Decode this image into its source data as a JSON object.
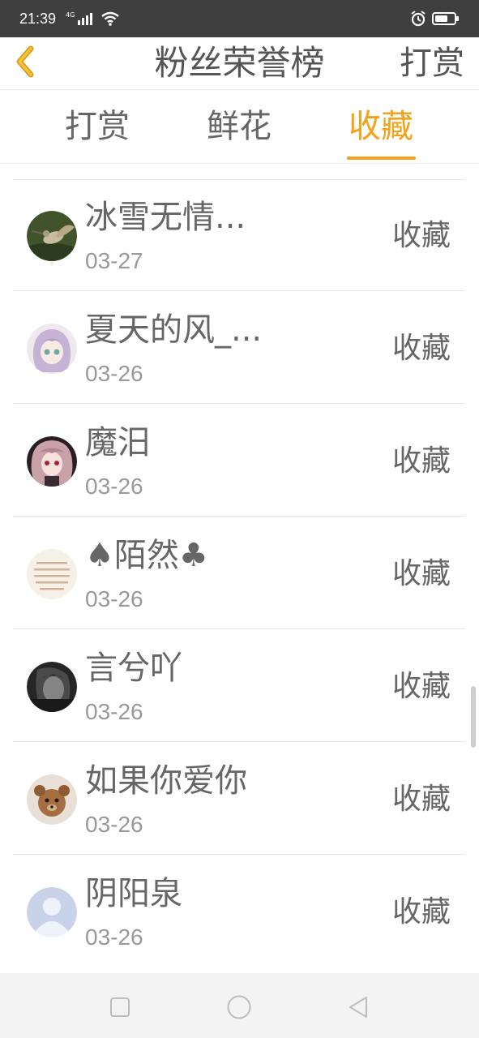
{
  "status_bar": {
    "time": "21:39",
    "network": "4G",
    "icons": [
      "signal-icon",
      "wifi-icon",
      "alarm-icon",
      "battery-icon"
    ]
  },
  "header": {
    "back_icon": "chevron-left-icon",
    "title": "粉丝荣誉榜",
    "action": "打赏"
  },
  "tabs": [
    {
      "label": "打赏",
      "active": false
    },
    {
      "label": "鲜花",
      "active": false
    },
    {
      "label": "收藏",
      "active": true
    }
  ],
  "items": [
    {
      "name": "冰雪无情...",
      "date": "03-27",
      "action": "收藏",
      "avatar": "hummingbird-avatar-icon"
    },
    {
      "name": "夏天的风_...",
      "date": "03-26",
      "action": "收藏",
      "avatar": "anime-purple-hair-avatar-icon"
    },
    {
      "name": "魔汨",
      "date": "03-26",
      "action": "收藏",
      "avatar": "anime-dark-hair-avatar-icon"
    },
    {
      "name": "♠陌然♣",
      "date": "03-26",
      "action": "收藏",
      "avatar": "text-card-avatar-icon"
    },
    {
      "name": "言兮吖",
      "date": "03-26",
      "action": "收藏",
      "avatar": "grayscale-person-avatar-icon"
    },
    {
      "name": "如果你爱你",
      "date": "03-26",
      "action": "收藏",
      "avatar": "teddy-bear-avatar-icon"
    },
    {
      "name": "阴阳泉",
      "date": "03-26",
      "action": "收藏",
      "avatar": "default-user-avatar-icon"
    }
  ],
  "bottom_nav": {
    "icons": [
      "square-recent-icon",
      "circle-home-icon",
      "triangle-back-icon"
    ]
  },
  "colors": {
    "accent": "#f2a21b",
    "text_primary": "#666666",
    "text_secondary": "#999999",
    "status_bar": "#3f3f3f"
  }
}
